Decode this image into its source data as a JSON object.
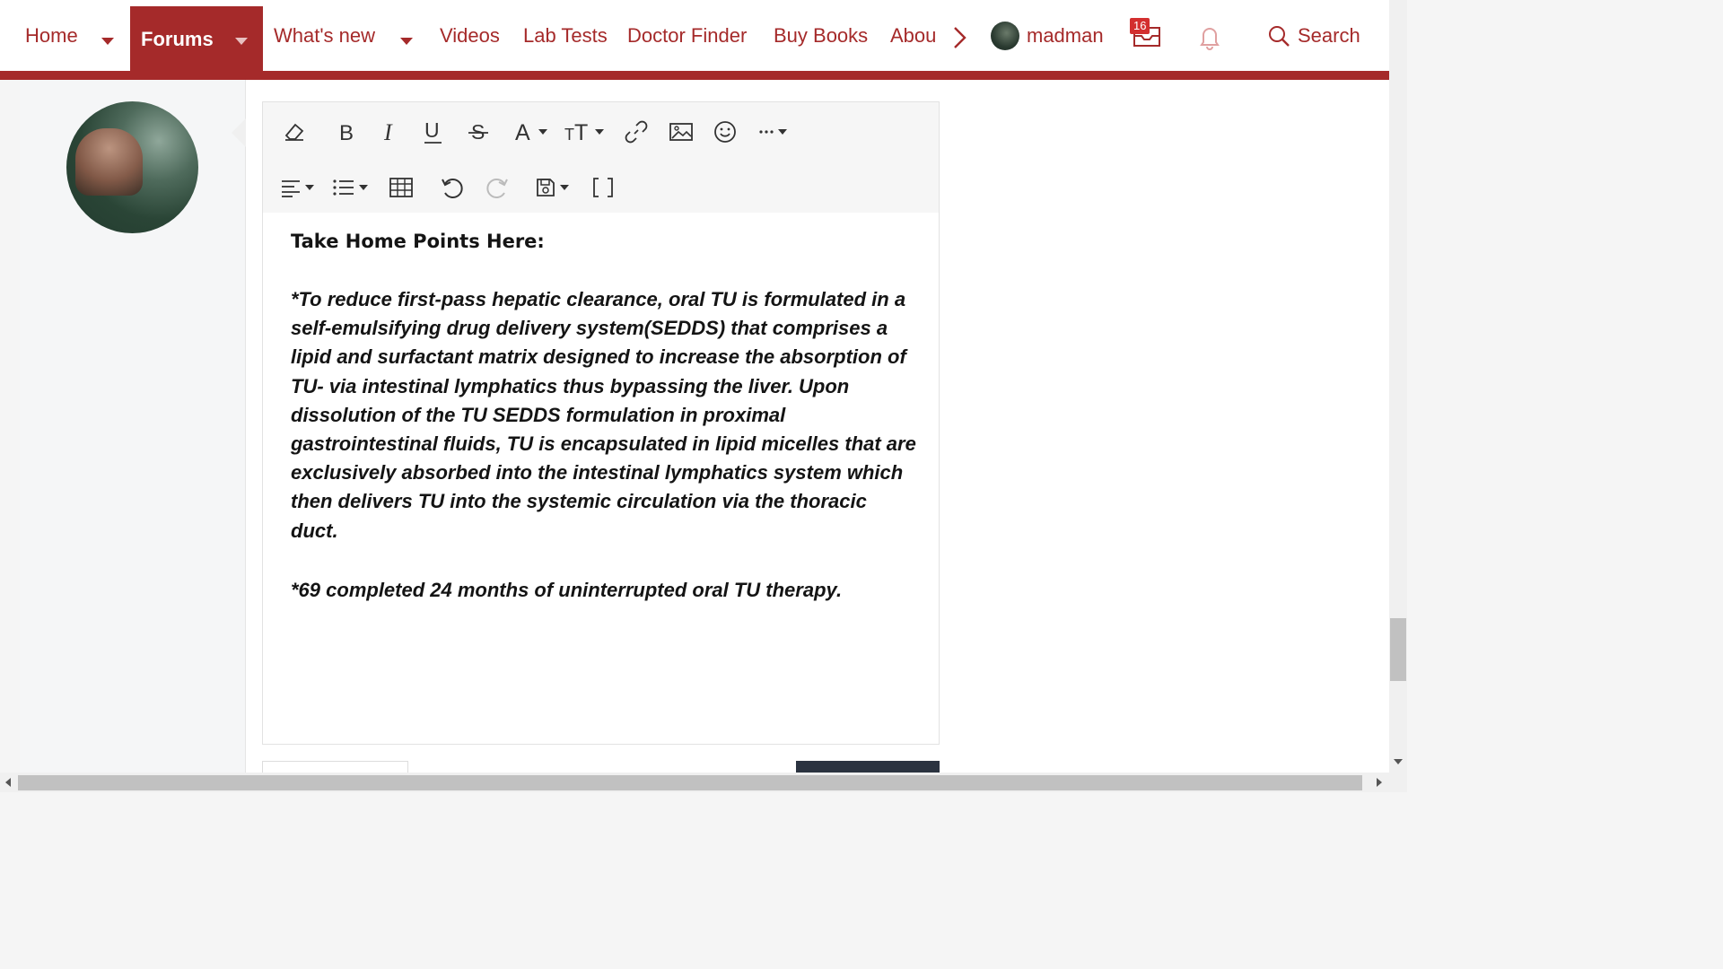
{
  "nav": {
    "items": [
      {
        "label": "Home"
      },
      {
        "label": "Forums"
      },
      {
        "label": "What's new"
      },
      {
        "label": "Videos"
      },
      {
        "label": "Lab Tests"
      },
      {
        "label": "Doctor Finder"
      },
      {
        "label": "Buy Books"
      },
      {
        "label": "Abou"
      }
    ],
    "user": {
      "name": "madman"
    },
    "inbox_count": "16",
    "search_label": "Search"
  },
  "colors": {
    "accent": "#a52a2a",
    "badge": "#d32f2f"
  },
  "toolbar": {
    "row1": [
      "eraser-icon",
      "bold-icon",
      "italic-icon",
      "underline-icon",
      "strikethrough-icon",
      "font-color-icon",
      "font-size-icon",
      "link-icon",
      "image-icon",
      "smiley-icon",
      "more-icon"
    ],
    "row2": [
      "align-icon",
      "list-icon",
      "table-icon",
      "undo-icon",
      "redo-icon",
      "drafts-icon",
      "bbcode-icon"
    ]
  },
  "editor": {
    "heading": "Take Home Points Here:",
    "para1": "*To reduce first-pass hepatic clearance, oral TU is formulated in a self-emulsifying drug delivery system(SEDDS) that comprises a lipid and surfactant matrix designed to increase the absorption of TU- via intestinal lymphatics thus bypassing the liver. Upon dissolution of the TU SEDDS formulation in proximal gastrointestinal fluids, TU is encapsulated in lipid micelles that are exclusively absorbed into the intestinal lymphatics system which then delivers TU into the systemic circulation via the thoracic duct.",
    "para2": "*69 completed 24 months of uninterrupted oral TU therapy."
  }
}
